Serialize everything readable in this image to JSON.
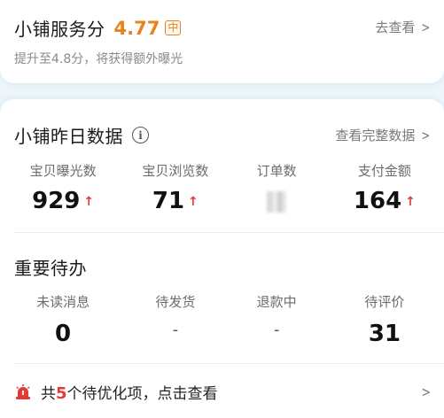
{
  "service": {
    "title": "小铺服务分",
    "score": "4.77",
    "badge": "中",
    "link": "去查看",
    "subtitle": "提升至4.8分，将获得额外曝光"
  },
  "yesterday": {
    "title": "小铺昨日数据",
    "link": "查看完整数据",
    "metrics": [
      {
        "label": "宝贝曝光数",
        "value": "929",
        "trend": "up"
      },
      {
        "label": "宝贝浏览数",
        "value": "71",
        "trend": "up"
      },
      {
        "label": "订单数",
        "value": "",
        "trend": "hidden"
      },
      {
        "label": "支付金额",
        "value": "164",
        "trend": "up"
      }
    ]
  },
  "todo": {
    "title": "重要待办",
    "items": [
      {
        "label": "未读消息",
        "value": "0"
      },
      {
        "label": "待发货",
        "value": "-"
      },
      {
        "label": "退款中",
        "value": "-"
      },
      {
        "label": "待评价",
        "value": "31"
      }
    ]
  },
  "promo": {
    "prefix": "共",
    "count": "5",
    "suffix": "个待优化项，点击查看"
  },
  "colors": {
    "accent": "#e8821e",
    "trend_up": "#e53935"
  }
}
